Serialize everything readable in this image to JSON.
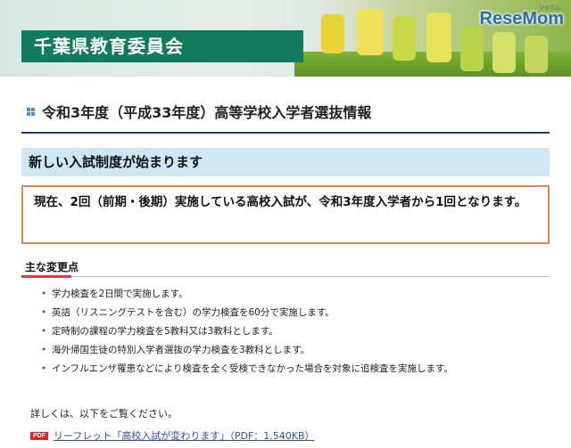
{
  "header": {
    "title": "千葉県教育委員会",
    "logo": "ReseMom",
    "logo_sub": "リセマム"
  },
  "page": {
    "title": "令和3年度（平成33年度）高等学校入学者選抜情報"
  },
  "section": {
    "title": "新しい入試制度が始まります"
  },
  "notice": {
    "text": "現在、2回（前期・後期）実施している高校入試が、令和3年度入学者から1回となります。"
  },
  "changes": {
    "label": "主な変更点",
    "items": [
      "学力検査を2日間で実施します。",
      "英語（リスニングテストを含む）の学力検査を60分で実施します。",
      "定時制の課程の学力検査を5教科又は3教科とします。",
      "海外帰国生徒の特別入学者選抜の学力検査を3教科とします。",
      "インフルエンザ罹患などにより検査を全く受検できなかった場合を対象に追検査を実施します。"
    ]
  },
  "footer": {
    "details_text": "詳しくは、以下をご覧ください。",
    "pdf_badge": "PDF",
    "pdf_link": "リーフレット「高校入試が変わります」（PDF：1,540KB）"
  },
  "colors": {
    "title_band": "#127a5d",
    "heading_rule": "#1e3e6a",
    "section_bg": "#cfe6f3",
    "notice_border": "#e0874d",
    "accent_red": "#e23a3a",
    "link": "#2c4fa8"
  }
}
